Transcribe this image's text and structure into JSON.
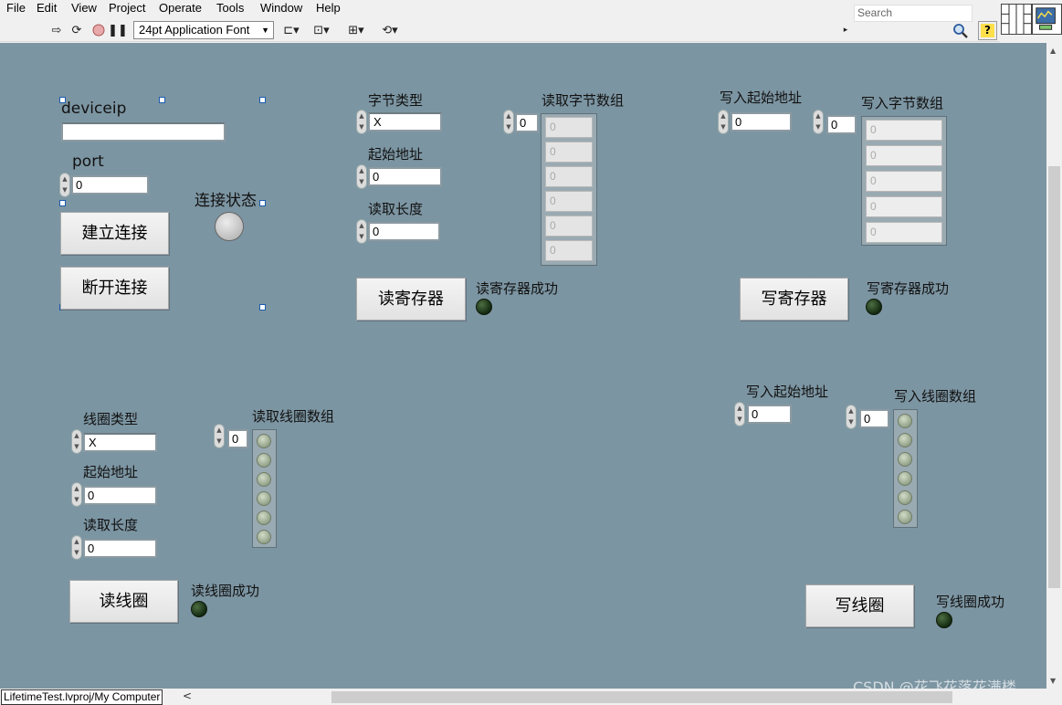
{
  "menu": [
    "File",
    "Edit",
    "View",
    "Project",
    "Operate",
    "Tools",
    "Window",
    "Help"
  ],
  "toolbar": {
    "font": "24pt Application Font",
    "search_placeholder": "Search",
    "help": "?"
  },
  "connection": {
    "deviceip_label": "deviceip",
    "deviceip_value": "",
    "port_label": "port",
    "port_value": "0",
    "status_label": "连接状态",
    "connect_button": "建立连接",
    "disconnect_button": "断开连接"
  },
  "read_register": {
    "type_label": "字节类型",
    "type_value": "X",
    "start_label": "起始地址",
    "start_value": "0",
    "length_label": "读取长度",
    "length_value": "0",
    "array_label": "读取字节数组",
    "array_index": "0",
    "array_values": [
      "0",
      "0",
      "0",
      "0",
      "0",
      "0"
    ],
    "button": "读寄存器",
    "success_label": "读寄存器成功"
  },
  "write_register": {
    "start_label": "写入起始地址",
    "start_value": "0",
    "array_label": "写入字节数组",
    "array_index": "0",
    "array_values": [
      "0",
      "0",
      "0",
      "0",
      "0"
    ],
    "button": "写寄存器",
    "success_label": "写寄存器成功"
  },
  "read_coil": {
    "type_label": "线圈类型",
    "type_value": "X",
    "start_label": "起始地址",
    "start_value": "0",
    "length_label": "读取长度",
    "length_value": "0",
    "array_label": "读取线圈数组",
    "array_index": "0",
    "button": "读线圈",
    "success_label": "读线圈成功"
  },
  "write_coil": {
    "start_label": "写入起始地址",
    "start_value": "0",
    "array_label": "写入线圈数组",
    "array_index": "0",
    "button": "写线圈",
    "success_label": "写线圈成功"
  },
  "status": {
    "project_path": "LifetimeTest.lvproj/My Computer",
    "watermark": "CSDN @花飞花落花满楼"
  },
  "colors": {
    "panel": "#7c95a2",
    "led_off_dark": "#1f3a1a",
    "status_led": "#cfcfcf"
  }
}
